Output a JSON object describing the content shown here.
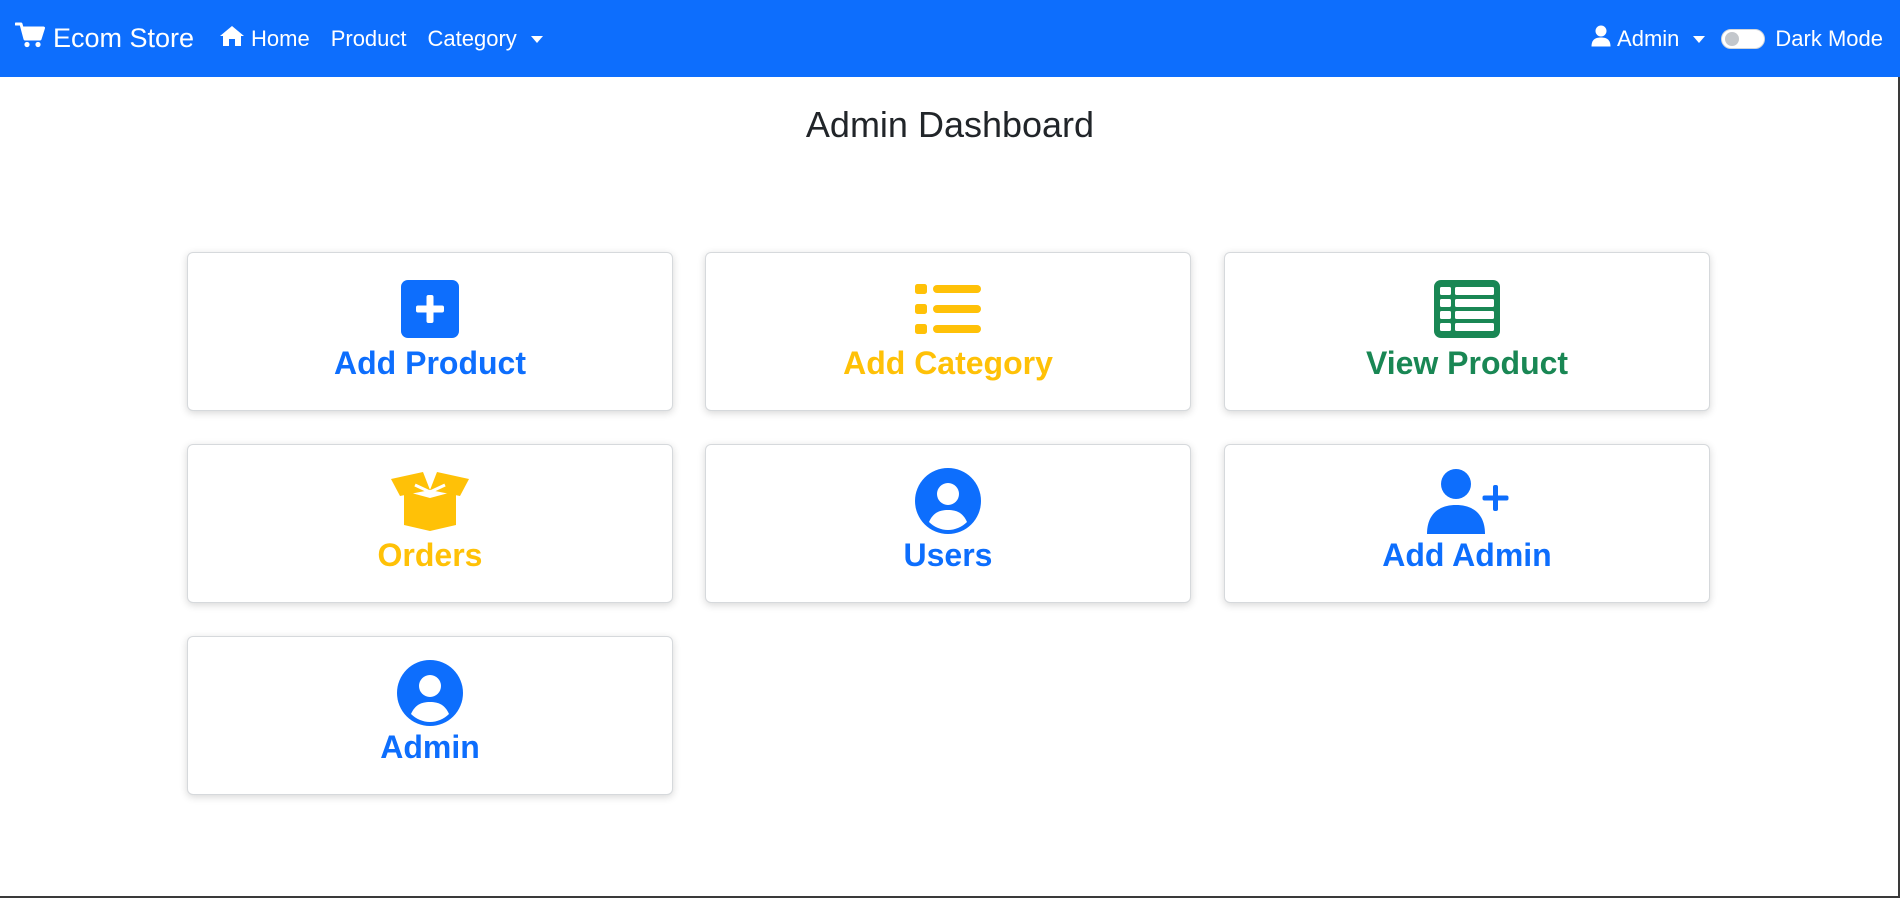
{
  "navbar": {
    "brand": "Ecom Store",
    "brand_icon": "shopping-cart-icon",
    "links": {
      "home": "Home",
      "product": "Product",
      "category": "Category"
    },
    "user": "Admin",
    "dark_mode_label": "Dark Mode",
    "dark_mode_enabled": false,
    "bar_color": "#0d6efd"
  },
  "page": {
    "title": "Admin Dashboard"
  },
  "cards": {
    "add_product": {
      "label": "Add Product",
      "icon": "plus-square-icon",
      "color": "#0d6efd"
    },
    "add_category": {
      "label": "Add Category",
      "icon": "list-icon",
      "color": "#ffc107"
    },
    "view_product": {
      "label": "View Product",
      "icon": "table-icon",
      "color": "#198754"
    },
    "orders": {
      "label": "Orders",
      "icon": "box-open-icon",
      "color": "#ffc107"
    },
    "users": {
      "label": "Users",
      "icon": "user-circle-icon",
      "color": "#0d6efd"
    },
    "add_admin": {
      "label": "Add Admin",
      "icon": "user-plus-icon",
      "color": "#0d6efd"
    },
    "admin": {
      "label": "Admin",
      "icon": "user-circle-icon",
      "color": "#0d6efd"
    }
  }
}
